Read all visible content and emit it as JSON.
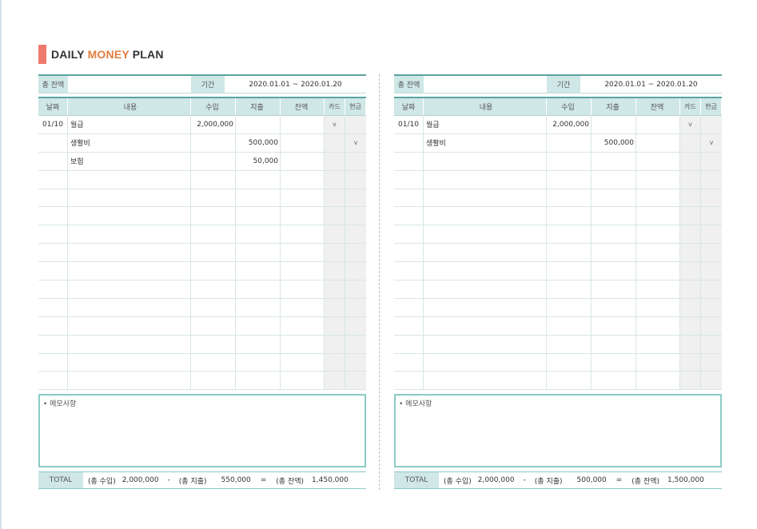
{
  "header": {
    "title_part1": "DAILY ",
    "title_part2": "MONEY",
    "title_part3": " PLAN"
  },
  "labels": {
    "total_balance": "총 잔액",
    "period": "기간",
    "columns": [
      "날짜",
      "내용",
      "수입",
      "지출",
      "잔액",
      "카드",
      "현금"
    ],
    "memo": "• 메모사항",
    "total": "TOTAL",
    "total_income": "(총 수입)",
    "total_expense": "(총 지출)",
    "total_balance_paren": "(총 잔액)",
    "minus": "-",
    "equals": "="
  },
  "sheets": [
    {
      "period": "2020.01.01 ~ 2020.01.20",
      "rows": [
        {
          "date": "01/10",
          "desc": "월급",
          "income": "2,000,000",
          "expense": "",
          "balance": "",
          "card": "v",
          "cash": ""
        },
        {
          "date": "",
          "desc": "생활비",
          "income": "",
          "expense": "500,000",
          "balance": "",
          "card": "",
          "cash": "v"
        },
        {
          "date": "",
          "desc": "보험",
          "income": "",
          "expense": "50,000",
          "balance": "",
          "card": "",
          "cash": ""
        }
      ],
      "totals": {
        "income": "2,000,000",
        "expense": "550,000",
        "balance": "1,450,000"
      }
    },
    {
      "period": "2020.01.01 ~ 2020.01.20",
      "rows": [
        {
          "date": "01/10",
          "desc": "월급",
          "income": "2,000,000",
          "expense": "",
          "balance": "",
          "card": "v",
          "cash": ""
        },
        {
          "date": "",
          "desc": "생활비",
          "income": "",
          "expense": "500,000",
          "balance": "",
          "card": "",
          "cash": "v"
        }
      ],
      "totals": {
        "income": "2,000,000",
        "expense": "500,000",
        "balance": "1,500,000"
      }
    }
  ],
  "colors": {
    "accent": "#ee7a6e",
    "money": "#e07d3c",
    "teal": "#5aa5a0",
    "header_fill": "#cfe7e6"
  }
}
